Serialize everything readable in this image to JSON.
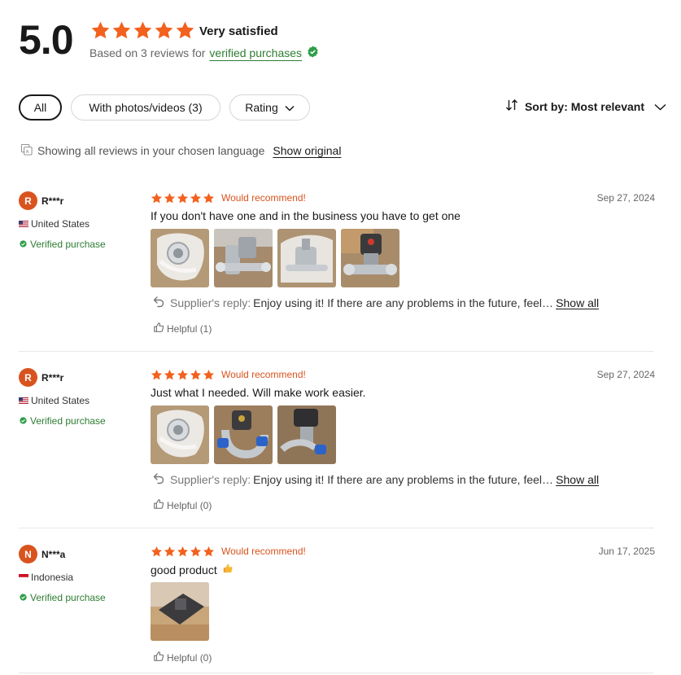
{
  "summary": {
    "score": "5.0",
    "stars": 5,
    "verdict": "Very satisfied",
    "based_on": "Based on 3 reviews for",
    "verified_link": "verified purchases"
  },
  "filters": {
    "all": "All",
    "with_photos": "With photos/videos (3)",
    "rating": "Rating"
  },
  "sort": {
    "label": "Sort by: Most relevant"
  },
  "language": {
    "note": "Showing all reviews in your chosen language",
    "show_original": "Show original"
  },
  "reviews": [
    {
      "initial": "R",
      "name": "R***r",
      "country": "United States",
      "flag": "us-flag-icon",
      "verified": "Verified purchase",
      "stars": 5,
      "recommend": "Would recommend!",
      "date": "Sep 27, 2024",
      "comment": "If you don't have one and in the business you have to get one",
      "photos": 4,
      "reply_label": "Supplier's reply:",
      "reply_text": "Enjoy using it! If there are any problems in the future, feel free to contact us.",
      "reply_ellipsis": "...",
      "show_all": "Show all",
      "helpful": "Helpful (1)"
    },
    {
      "initial": "R",
      "name": "R***r",
      "country": "United States",
      "flag": "us-flag-icon",
      "verified": "Verified purchase",
      "stars": 5,
      "recommend": "Would recommend!",
      "date": "Sep 27, 2024",
      "comment": "Just what I needed. Will make work easier.",
      "photos": 3,
      "reply_label": "Supplier's reply:",
      "reply_text": "Enjoy using it! If there are any problems in the future, feel free to contact us.",
      "reply_ellipsis": "...",
      "show_all": "Show all",
      "helpful": "Helpful (0)"
    },
    {
      "initial": "N",
      "name": "N***a",
      "country": "Indonesia",
      "flag": "id-flag-icon",
      "verified": "Verified purchase",
      "stars": 5,
      "recommend": "Would recommend!",
      "date": "Jun 17, 2025",
      "comment": "good product",
      "comment_emoji": "thumbs-up-icon",
      "photos": 1,
      "helpful": "Helpful (0)"
    }
  ],
  "colors": {
    "accent": "#d9531e",
    "star": "#f2611d",
    "verified": "#2e7d32",
    "text": "#191919",
    "muted": "#666666"
  }
}
